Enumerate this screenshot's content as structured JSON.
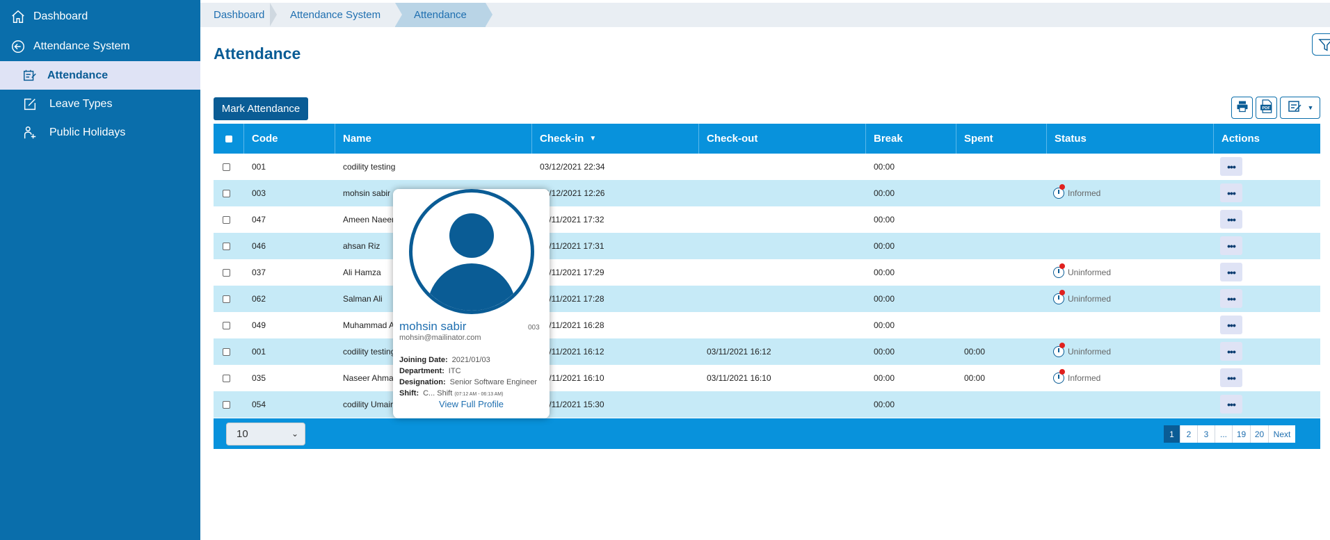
{
  "sidebar": {
    "items": [
      {
        "label": "Dashboard",
        "icon": "home-icon"
      },
      {
        "label": "Attendance System",
        "icon": "back-circle-icon"
      },
      {
        "label": "Attendance",
        "icon": "attendance-icon",
        "active": true
      },
      {
        "label": "Leave Types",
        "icon": "edit-icon"
      },
      {
        "label": "Public Holidays",
        "icon": "holiday-icon"
      }
    ]
  },
  "breadcrumb": [
    "Dashboard",
    "Attendance System",
    "Attendance"
  ],
  "page": {
    "title": "Attendance",
    "mark_button": "Mark Attendance"
  },
  "table": {
    "columns": [
      "Code",
      "Name",
      "Check-in",
      "Check-out",
      "Break",
      "Spent",
      "Status",
      "Actions"
    ],
    "sorted_column": "Check-in",
    "rows": [
      {
        "code": "001",
        "name": "codility testing",
        "checkin": "03/12/2021 22:34",
        "checkout": "",
        "break": "00:00",
        "spent": "",
        "status": ""
      },
      {
        "code": "003",
        "name": "mohsin sabir",
        "checkin": "03/12/2021 12:26",
        "checkout": "",
        "break": "00:00",
        "spent": "",
        "status": "Informed"
      },
      {
        "code": "047",
        "name": "Ameen Naeem",
        "checkin": "03/11/2021 17:32",
        "checkout": "",
        "break": "00:00",
        "spent": "",
        "status": ""
      },
      {
        "code": "046",
        "name": "ahsan Riz",
        "checkin": "03/11/2021 17:31",
        "checkout": "",
        "break": "00:00",
        "spent": "",
        "status": ""
      },
      {
        "code": "037",
        "name": "Ali Hamza",
        "checkin": "03/11/2021 17:29",
        "checkout": "",
        "break": "00:00",
        "spent": "",
        "status": "Uninformed"
      },
      {
        "code": "062",
        "name": "Salman Ali",
        "checkin": "03/11/2021 17:28",
        "checkout": "",
        "break": "00:00",
        "spent": "",
        "status": "Uninformed"
      },
      {
        "code": "049",
        "name": "Muhammad A",
        "checkin": "03/11/2021 16:28",
        "checkout": "",
        "break": "00:00",
        "spent": "",
        "status": ""
      },
      {
        "code": "001",
        "name": "codility testing",
        "checkin": "03/11/2021 16:12",
        "checkout": "03/11/2021 16:12",
        "break": "00:00",
        "spent": "00:00",
        "status": "Uninformed"
      },
      {
        "code": "035",
        "name": "Naseer Ahmad",
        "checkin": "03/11/2021 16:10",
        "checkout": "03/11/2021 16:10",
        "break": "00:00",
        "spent": "00:00",
        "status": "Informed"
      },
      {
        "code": "054",
        "name": "codility Umair",
        "checkin": "03/11/2021 15:30",
        "checkout": "",
        "break": "00:00",
        "spent": "",
        "status": ""
      }
    ],
    "action_label": "•••"
  },
  "pagination": {
    "page_size": "10",
    "pages": [
      "1",
      "2",
      "3",
      "...",
      "19",
      "20",
      "Next"
    ],
    "current": "1"
  },
  "popup": {
    "name": "mohsin sabir",
    "code": "003",
    "email": "mohsin@mailinator.com",
    "joining_label": "Joining Date:",
    "joining": "2021/01/03",
    "department_label": "Department:",
    "department": "ITC",
    "designation_label": "Designation:",
    "designation": "Senior Software Engineer",
    "shift_label": "Shift:",
    "shift": "C... Shift",
    "shift_time": "(07:12 AM - 06:13 AM)",
    "link": "View Full Profile"
  },
  "colors": {
    "sidebar": "#0a6eab",
    "header": "#0892dc",
    "row_alt": "#c6eaf7",
    "accent": "#0a5c95",
    "badge": "#e0211f"
  }
}
